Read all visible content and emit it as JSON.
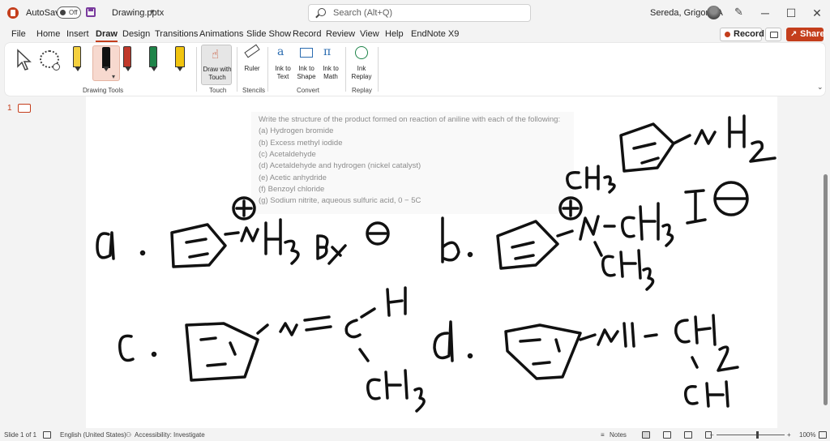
{
  "titlebar": {
    "autosave_label": "AutoSave",
    "autosave_state": "Off",
    "doc_title": "Drawing.pptx",
    "search_placeholder": "Search (Alt+Q)",
    "user_name": "Sereda, Grigoriy A",
    "minimize": "─",
    "maximize": "☐",
    "close": "✕"
  },
  "menu": {
    "tabs": [
      "File",
      "Home",
      "Insert",
      "Draw",
      "Design",
      "Transitions",
      "Animations",
      "Slide Show",
      "Record",
      "Review",
      "View",
      "Help",
      "EndNote X9"
    ],
    "active_tab": "Draw",
    "record_label": "Record",
    "share_label": "Share"
  },
  "ribbon": {
    "pen_colors": [
      "#f4d03f",
      "#111111",
      "#c0392b",
      "#1e8449",
      "#f1c40f"
    ],
    "draw_with_touch": "Draw with Touch",
    "ruler": "Ruler",
    "ink_to_text": "Ink to Text",
    "ink_to_shape": "Ink to Shape",
    "ink_to_math": "Ink to Math",
    "ink_replay": "Ink Replay",
    "groups": {
      "drawing_tools": "Drawing Tools",
      "touch": "Touch",
      "stencils": "Stencils",
      "convert": "Convert",
      "replay": "Replay"
    }
  },
  "slides_panel": {
    "slide_number": "1"
  },
  "slide": {
    "question_lines": [
      "Write the structure of the product formed on reaction of aniline with each of the following:",
      "(a) Hydrogen bromide",
      "(b) Excess methyl iodide",
      "(c) Acetaldehyde",
      "(d) Acetaldehyde and hydrogen (nickel catalyst)",
      "(e) Acetic anhydride",
      "(f) Benzoyl chloride",
      "(g) Sodium nitrite, aqueous sulfuric acid, 0 − 5C"
    ],
    "ink_color": "#111111"
  },
  "statusbar": {
    "slide_info": "Slide 1 of 1",
    "language": "English (United States)",
    "accessibility": "Accessibility: Investigate",
    "notes": "Notes",
    "zoom": "100%"
  }
}
